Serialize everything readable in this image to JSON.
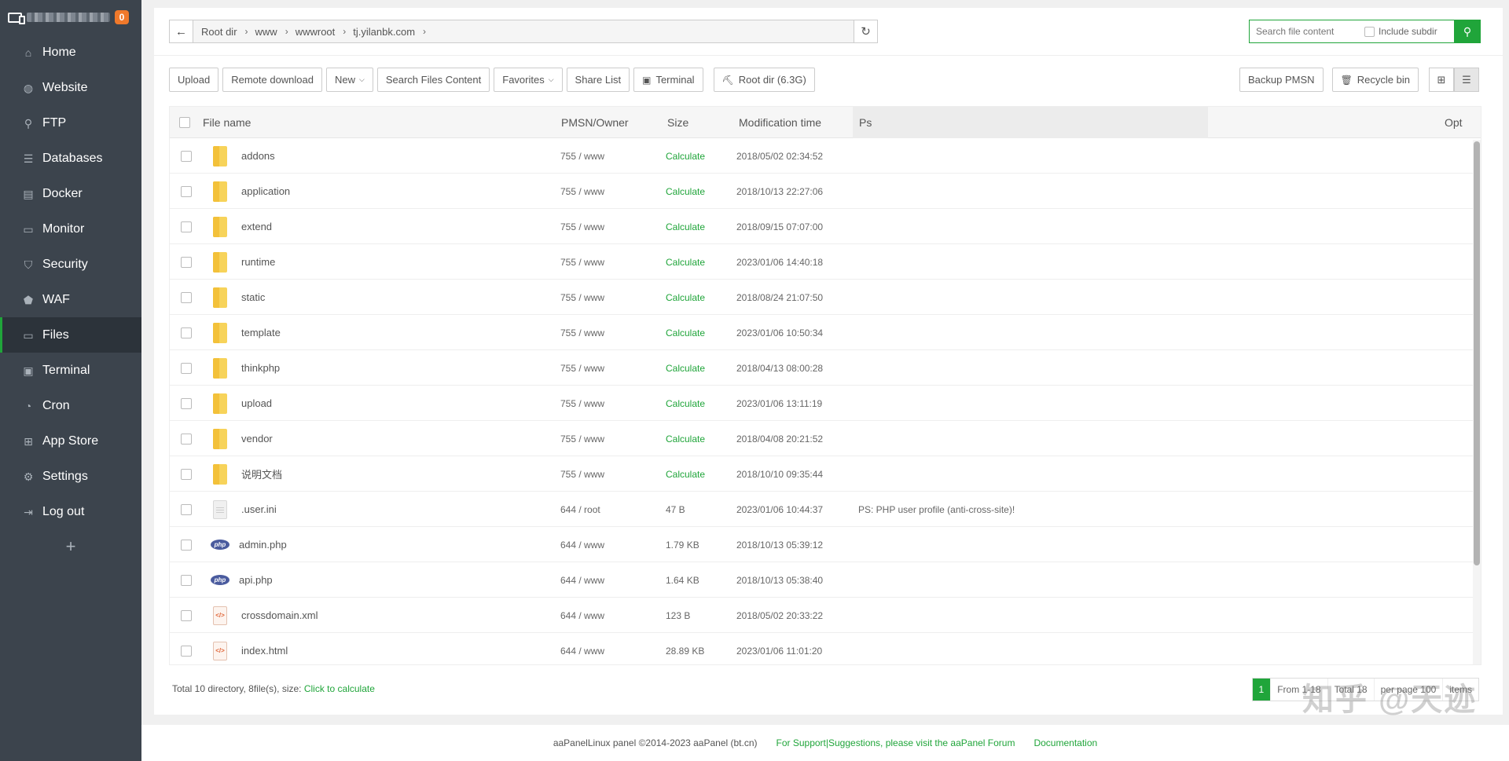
{
  "sidebar": {
    "badge": "0",
    "items": [
      {
        "label": "Home",
        "icon": "home-icon",
        "glyph": "⌂"
      },
      {
        "label": "Website",
        "icon": "globe-icon",
        "glyph": "◍"
      },
      {
        "label": "FTP",
        "icon": "ftp-icon",
        "glyph": "⚲"
      },
      {
        "label": "Databases",
        "icon": "database-icon",
        "glyph": "☰"
      },
      {
        "label": "Docker",
        "icon": "docker-icon",
        "glyph": "▤"
      },
      {
        "label": "Monitor",
        "icon": "monitor-icon",
        "glyph": "▭"
      },
      {
        "label": "Security",
        "icon": "shield-icon",
        "glyph": "⛉"
      },
      {
        "label": "WAF",
        "icon": "waf-shield-icon",
        "glyph": "⬟"
      },
      {
        "label": "Files",
        "icon": "folder-icon",
        "glyph": "▭",
        "active": true
      },
      {
        "label": "Terminal",
        "icon": "terminal-icon",
        "glyph": "▣"
      },
      {
        "label": "Cron",
        "icon": "clock-icon",
        "glyph": "◔"
      },
      {
        "label": "App Store",
        "icon": "grid-icon",
        "glyph": "⊞"
      },
      {
        "label": "Settings",
        "icon": "gear-icon",
        "glyph": "⚙"
      },
      {
        "label": "Log out",
        "icon": "logout-icon",
        "glyph": "⇥"
      }
    ],
    "add": "+"
  },
  "path": {
    "crumbs": [
      "Root dir",
      "www",
      "wwwroot",
      "tj.yilanbk.com"
    ]
  },
  "search": {
    "placeholder": "Search file content",
    "include_subdir": "Include subdir"
  },
  "toolbar": {
    "upload": "Upload",
    "remote_download": "Remote download",
    "new": "New",
    "search_files": "Search Files Content",
    "favorites": "Favorites",
    "share_list": "Share List",
    "terminal": "Terminal",
    "root_dir": "Root dir (6.3G)",
    "backup": "Backup PMSN",
    "recycle": "Recycle bin"
  },
  "table": {
    "headers": {
      "name": "File name",
      "perm": "PMSN/Owner",
      "size": "Size",
      "time": "Modification time",
      "ps": "Ps",
      "opt": "Opt"
    },
    "rows": [
      {
        "name": "addons",
        "type": "folder",
        "perm": "755 / www",
        "size": "Calculate",
        "time": "2018/05/02 02:34:52",
        "ps": ""
      },
      {
        "name": "application",
        "type": "folder",
        "perm": "755 / www",
        "size": "Calculate",
        "time": "2018/10/13 22:27:06",
        "ps": ""
      },
      {
        "name": "extend",
        "type": "folder",
        "perm": "755 / www",
        "size": "Calculate",
        "time": "2018/09/15 07:07:00",
        "ps": ""
      },
      {
        "name": "runtime",
        "type": "folder",
        "perm": "755 / www",
        "size": "Calculate",
        "time": "2023/01/06 14:40:18",
        "ps": ""
      },
      {
        "name": "static",
        "type": "folder",
        "perm": "755 / www",
        "size": "Calculate",
        "time": "2018/08/24 21:07:50",
        "ps": ""
      },
      {
        "name": "template",
        "type": "folder",
        "perm": "755 / www",
        "size": "Calculate",
        "time": "2023/01/06 10:50:34",
        "ps": ""
      },
      {
        "name": "thinkphp",
        "type": "folder",
        "perm": "755 / www",
        "size": "Calculate",
        "time": "2018/04/13 08:00:28",
        "ps": ""
      },
      {
        "name": "upload",
        "type": "folder",
        "perm": "755 / www",
        "size": "Calculate",
        "time": "2023/01/06 13:11:19",
        "ps": ""
      },
      {
        "name": "vendor",
        "type": "folder",
        "perm": "755 / www",
        "size": "Calculate",
        "time": "2018/04/08 20:21:52",
        "ps": ""
      },
      {
        "name": "说明文档",
        "type": "folder",
        "perm": "755 / www",
        "size": "Calculate",
        "time": "2018/10/10 09:35:44",
        "ps": ""
      },
      {
        "name": ".user.ini",
        "type": "doc",
        "perm": "644 / root",
        "size": "47 B",
        "time": "2023/01/06 10:44:37",
        "ps": "PS: PHP user profile (anti-cross-site)!"
      },
      {
        "name": "admin.php",
        "type": "php",
        "perm": "644 / www",
        "size": "1.79 KB",
        "time": "2018/10/13 05:39:12",
        "ps": ""
      },
      {
        "name": "api.php",
        "type": "php",
        "perm": "644 / www",
        "size": "1.64 KB",
        "time": "2018/10/13 05:38:40",
        "ps": ""
      },
      {
        "name": "crossdomain.xml",
        "type": "xml",
        "perm": "644 / www",
        "size": "123 B",
        "time": "2018/05/02 20:33:22",
        "ps": ""
      },
      {
        "name": "index.html",
        "type": "xml",
        "perm": "644 / www",
        "size": "28.89 KB",
        "time": "2023/01/06 11:01:20",
        "ps": ""
      }
    ]
  },
  "summary": {
    "text": "Total 10 directory, 8file(s), size: ",
    "link": "Click to calculate"
  },
  "pager": {
    "current": "1",
    "from": "From 1-18",
    "total": "Total 18",
    "per_page": "per page 100",
    "items": "items"
  },
  "watermark": "知乎 @天迹以蓝",
  "footer": {
    "copyright": "aaPanelLinux panel ©2014-2023 aaPanel (bt.cn)",
    "support": "For Support|Suggestions, please visit the aaPanel Forum",
    "docs": "Documentation"
  },
  "colors": {
    "accent": "#20a53a",
    "sidebar": "#3c444d",
    "badge": "#f0792b"
  }
}
